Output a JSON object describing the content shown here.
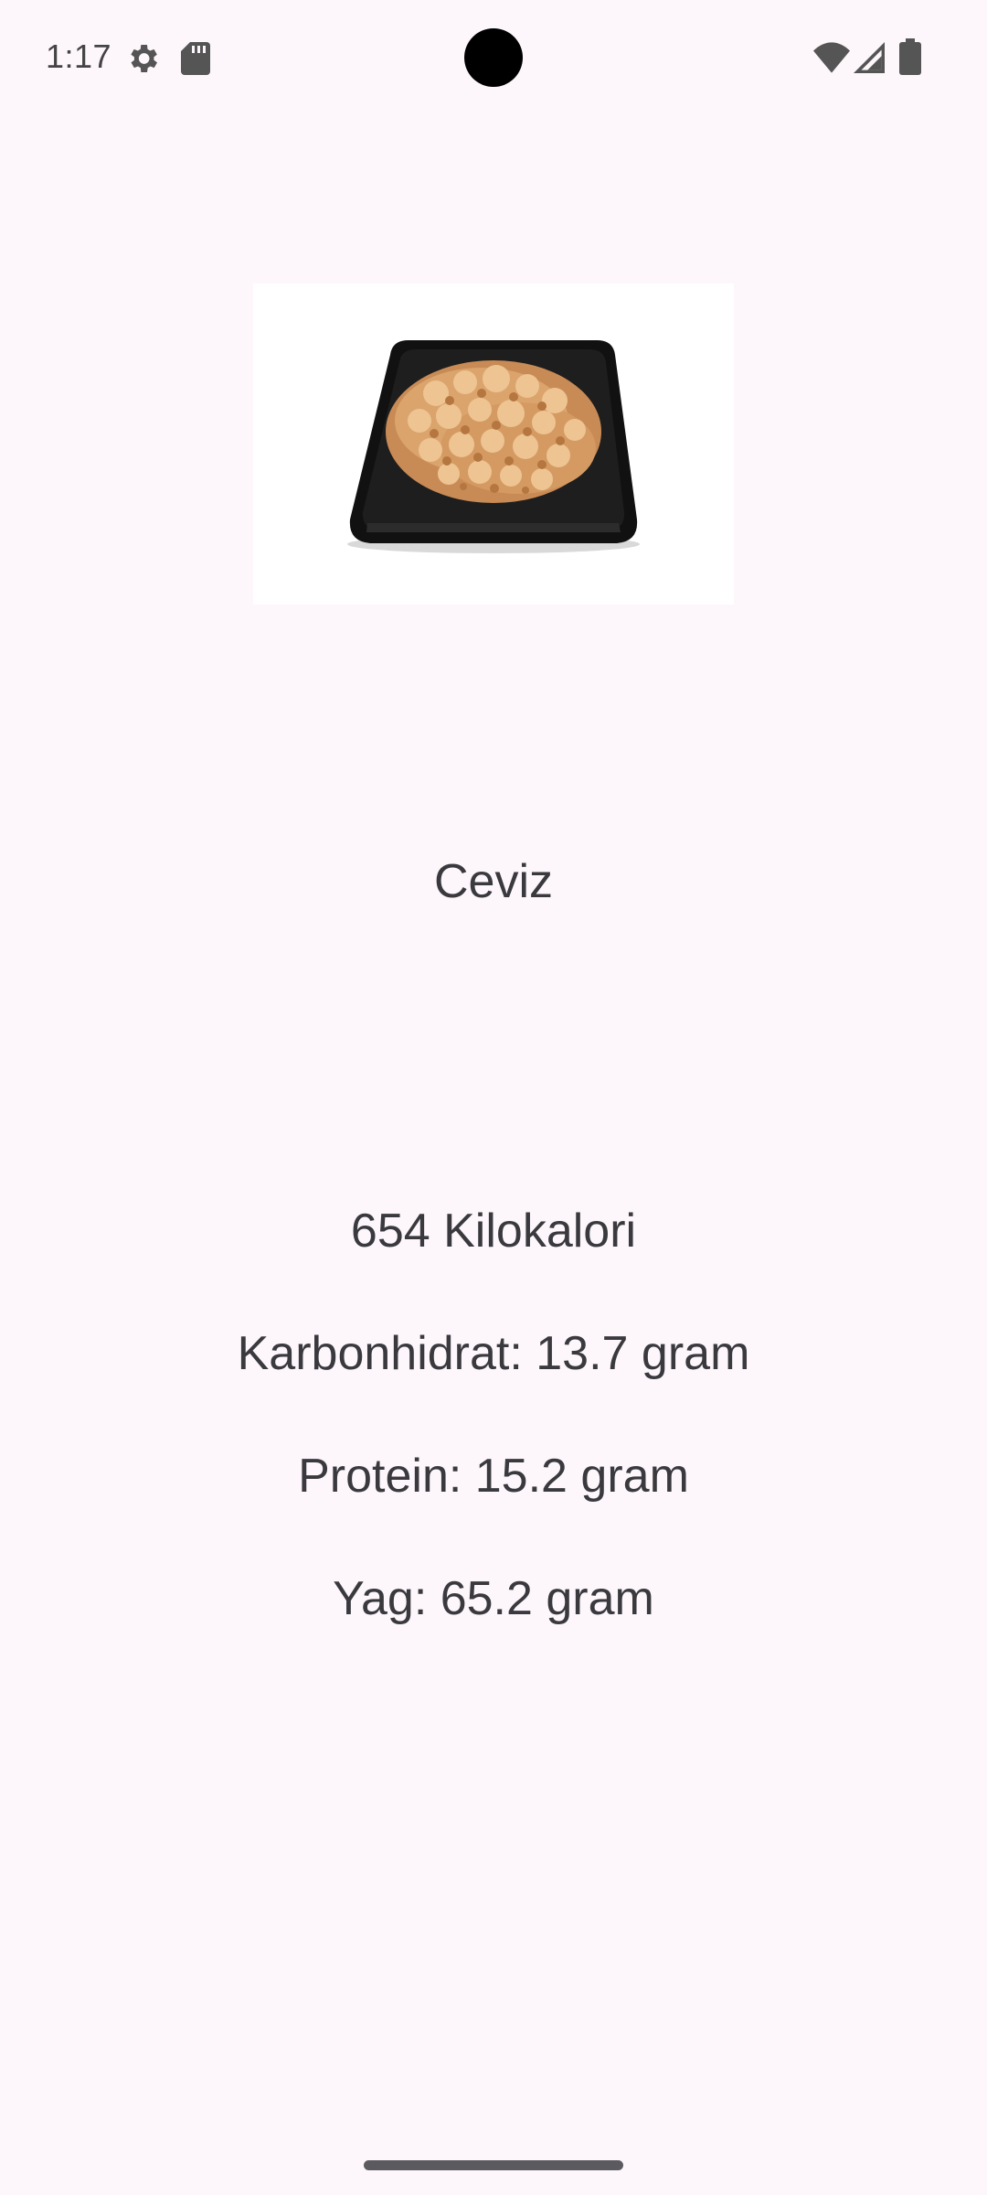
{
  "status_bar": {
    "time": "1:17",
    "icons": [
      "settings-gear-icon",
      "sd-card-icon",
      "wifi-icon",
      "cell-signal-icon",
      "battery-icon"
    ]
  },
  "food": {
    "image_icon": "walnuts-plate-image",
    "name": "Ceviz"
  },
  "nutrition": {
    "calories": "654 Kilokalori",
    "carbohydrate": "Karbonhidrat: 13.7 gram",
    "protein": "Protein: 15.2 gram",
    "fat": "Yag: 65.2 gram"
  },
  "colors": {
    "background": "#fdf7fc",
    "text": "#3a3a3e"
  }
}
